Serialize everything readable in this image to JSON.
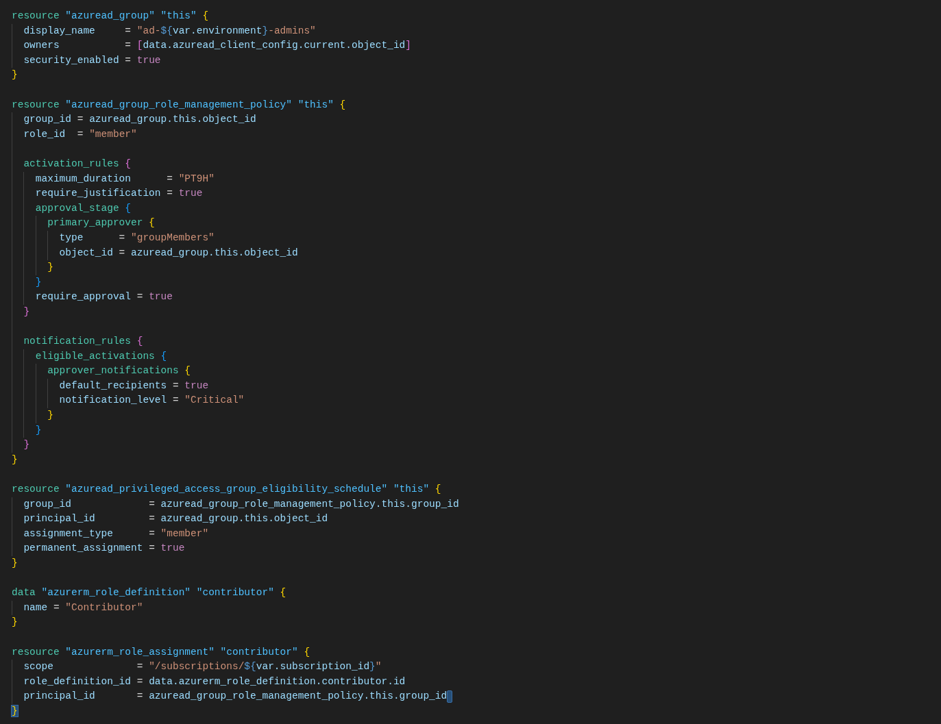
{
  "editor": {
    "lines": [
      {
        "kind": "block",
        "head": [
          {
            "text": "resource ",
            "kind": "kw"
          },
          {
            "text": "\"azuread_group\" \"this\" ",
            "kind": "rtype"
          },
          {
            "text": "{",
            "kind": "b1"
          }
        ],
        "children": [
          {
            "kind": "line",
            "cursor": false,
            "t": [
              {
                "text": "display_name     ",
                "kind": "attr"
              },
              {
                "text": "= ",
                "kind": "plain"
              },
              {
                "text": "\"ad-",
                "kind": "str"
              },
              {
                "text": "${",
                "kind": "interp"
              },
              {
                "text": "var.environment",
                "kind": "attr"
              },
              {
                "text": "}",
                "kind": "interp"
              },
              {
                "text": "-admins\"",
                "kind": "str"
              }
            ]
          },
          {
            "kind": "line",
            "cursor": false,
            "t": [
              {
                "text": "owners           ",
                "kind": "attr"
              },
              {
                "text": "= ",
                "kind": "plain"
              },
              {
                "text": "[",
                "kind": "b2"
              },
              {
                "text": "data.azuread_client_config.current.object_id",
                "kind": "attr"
              },
              {
                "text": "]",
                "kind": "b2"
              }
            ]
          },
          {
            "kind": "line",
            "cursor": false,
            "t": [
              {
                "text": "security_enabled ",
                "kind": "attr"
              },
              {
                "text": "= ",
                "kind": "plain"
              },
              {
                "text": "true",
                "kind": "bool"
              }
            ]
          }
        ],
        "close": {
          "t": [
            {
              "text": "}",
              "kind": "b1"
            }
          ],
          "matched": false
        }
      },
      {
        "kind": "blank"
      },
      {
        "kind": "block",
        "head": [
          {
            "text": "resource ",
            "kind": "kw"
          },
          {
            "text": "\"azuread_group_role_management_policy\" \"this\" ",
            "kind": "rtype"
          },
          {
            "text": "{",
            "kind": "b1"
          }
        ],
        "children": [
          {
            "kind": "line",
            "cursor": false,
            "t": [
              {
                "text": "group_id ",
                "kind": "attr"
              },
              {
                "text": "= ",
                "kind": "plain"
              },
              {
                "text": "azuread_group.this.object_id",
                "kind": "attr"
              }
            ]
          },
          {
            "kind": "line",
            "cursor": false,
            "t": [
              {
                "text": "role_id  ",
                "kind": "attr"
              },
              {
                "text": "= ",
                "kind": "plain"
              },
              {
                "text": "\"member\"",
                "kind": "str"
              }
            ]
          },
          {
            "kind": "blank"
          },
          {
            "kind": "block",
            "head": [
              {
                "text": "activation_rules ",
                "kind": "block"
              },
              {
                "text": "{",
                "kind": "b2"
              }
            ],
            "children": [
              {
                "kind": "line",
                "cursor": false,
                "t": [
                  {
                    "text": "maximum_duration      ",
                    "kind": "attr"
                  },
                  {
                    "text": "= ",
                    "kind": "plain"
                  },
                  {
                    "text": "\"PT9H\"",
                    "kind": "str"
                  }
                ]
              },
              {
                "kind": "line",
                "cursor": false,
                "t": [
                  {
                    "text": "require_justification ",
                    "kind": "attr"
                  },
                  {
                    "text": "= ",
                    "kind": "plain"
                  },
                  {
                    "text": "true",
                    "kind": "bool"
                  }
                ]
              },
              {
                "kind": "block",
                "head": [
                  {
                    "text": "approval_stage ",
                    "kind": "block"
                  },
                  {
                    "text": "{",
                    "kind": "b3"
                  }
                ],
                "children": [
                  {
                    "kind": "block",
                    "head": [
                      {
                        "text": "primary_approver ",
                        "kind": "block"
                      },
                      {
                        "text": "{",
                        "kind": "b1"
                      }
                    ],
                    "children": [
                      {
                        "kind": "line",
                        "cursor": false,
                        "t": [
                          {
                            "text": "type      ",
                            "kind": "attr"
                          },
                          {
                            "text": "= ",
                            "kind": "plain"
                          },
                          {
                            "text": "\"groupMembers\"",
                            "kind": "str"
                          }
                        ]
                      },
                      {
                        "kind": "line",
                        "cursor": false,
                        "t": [
                          {
                            "text": "object_id ",
                            "kind": "attr"
                          },
                          {
                            "text": "= ",
                            "kind": "plain"
                          },
                          {
                            "text": "azuread_group.this.object_id",
                            "kind": "attr"
                          }
                        ]
                      }
                    ],
                    "close": {
                      "t": [
                        {
                          "text": "}",
                          "kind": "b1"
                        }
                      ],
                      "matched": false
                    }
                  }
                ],
                "close": {
                  "t": [
                    {
                      "text": "}",
                      "kind": "b3"
                    }
                  ],
                  "matched": false
                }
              },
              {
                "kind": "line",
                "cursor": false,
                "t": [
                  {
                    "text": "require_approval ",
                    "kind": "attr"
                  },
                  {
                    "text": "= ",
                    "kind": "plain"
                  },
                  {
                    "text": "true",
                    "kind": "bool"
                  }
                ]
              }
            ],
            "close": {
              "t": [
                {
                  "text": "}",
                  "kind": "b2"
                }
              ],
              "matched": false
            }
          },
          {
            "kind": "blank"
          },
          {
            "kind": "block",
            "head": [
              {
                "text": "notification_rules ",
                "kind": "block"
              },
              {
                "text": "{",
                "kind": "b2"
              }
            ],
            "children": [
              {
                "kind": "block",
                "head": [
                  {
                    "text": "eligible_activations ",
                    "kind": "block"
                  },
                  {
                    "text": "{",
                    "kind": "b3"
                  }
                ],
                "children": [
                  {
                    "kind": "block",
                    "head": [
                      {
                        "text": "approver_notifications ",
                        "kind": "block"
                      },
                      {
                        "text": "{",
                        "kind": "b1"
                      }
                    ],
                    "children": [
                      {
                        "kind": "line",
                        "cursor": false,
                        "t": [
                          {
                            "text": "default_recipients ",
                            "kind": "attr"
                          },
                          {
                            "text": "= ",
                            "kind": "plain"
                          },
                          {
                            "text": "true",
                            "kind": "bool"
                          }
                        ]
                      },
                      {
                        "kind": "line",
                        "cursor": false,
                        "t": [
                          {
                            "text": "notification_level ",
                            "kind": "attr"
                          },
                          {
                            "text": "= ",
                            "kind": "plain"
                          },
                          {
                            "text": "\"Critical\"",
                            "kind": "str"
                          }
                        ]
                      }
                    ],
                    "close": {
                      "t": [
                        {
                          "text": "}",
                          "kind": "b1"
                        }
                      ],
                      "matched": false
                    }
                  }
                ],
                "close": {
                  "t": [
                    {
                      "text": "}",
                      "kind": "b3"
                    }
                  ],
                  "matched": false
                }
              }
            ],
            "close": {
              "t": [
                {
                  "text": "}",
                  "kind": "b2"
                }
              ],
              "matched": false
            }
          }
        ],
        "close": {
          "t": [
            {
              "text": "}",
              "kind": "b1"
            }
          ],
          "matched": false
        }
      },
      {
        "kind": "blank"
      },
      {
        "kind": "block",
        "head": [
          {
            "text": "resource ",
            "kind": "kw"
          },
          {
            "text": "\"azuread_privileged_access_group_eligibility_schedule\" \"this\" ",
            "kind": "rtype"
          },
          {
            "text": "{",
            "kind": "b1"
          }
        ],
        "children": [
          {
            "kind": "line",
            "cursor": false,
            "t": [
              {
                "text": "group_id             ",
                "kind": "attr"
              },
              {
                "text": "= ",
                "kind": "plain"
              },
              {
                "text": "azuread_group_role_management_policy.this.group_id",
                "kind": "attr"
              }
            ]
          },
          {
            "kind": "line",
            "cursor": false,
            "t": [
              {
                "text": "principal_id         ",
                "kind": "attr"
              },
              {
                "text": "= ",
                "kind": "plain"
              },
              {
                "text": "azuread_group.this.object_id",
                "kind": "attr"
              }
            ]
          },
          {
            "kind": "line",
            "cursor": false,
            "t": [
              {
                "text": "assignment_type      ",
                "kind": "attr"
              },
              {
                "text": "= ",
                "kind": "plain"
              },
              {
                "text": "\"member\"",
                "kind": "str"
              }
            ]
          },
          {
            "kind": "line",
            "cursor": false,
            "t": [
              {
                "text": "permanent_assignment ",
                "kind": "attr"
              },
              {
                "text": "= ",
                "kind": "plain"
              },
              {
                "text": "true",
                "kind": "bool"
              }
            ]
          }
        ],
        "close": {
          "t": [
            {
              "text": "}",
              "kind": "b1"
            }
          ],
          "matched": false
        }
      },
      {
        "kind": "blank"
      },
      {
        "kind": "block",
        "head": [
          {
            "text": "data ",
            "kind": "kw"
          },
          {
            "text": "\"azurerm_role_definition\" \"contributor\" ",
            "kind": "rtype"
          },
          {
            "text": "{",
            "kind": "b1"
          }
        ],
        "children": [
          {
            "kind": "line",
            "cursor": false,
            "t": [
              {
                "text": "name ",
                "kind": "attr"
              },
              {
                "text": "= ",
                "kind": "plain"
              },
              {
                "text": "\"Contributor\"",
                "kind": "str"
              }
            ]
          }
        ],
        "close": {
          "t": [
            {
              "text": "}",
              "kind": "b1"
            }
          ],
          "matched": false
        }
      },
      {
        "kind": "blank"
      },
      {
        "kind": "block",
        "head": [
          {
            "text": "resource ",
            "kind": "kw"
          },
          {
            "text": "\"azurerm_role_assignment\" \"contributor\" ",
            "kind": "rtype"
          },
          {
            "text": "{",
            "kind": "b1"
          }
        ],
        "children": [
          {
            "kind": "line",
            "cursor": false,
            "t": [
              {
                "text": "scope              ",
                "kind": "attr"
              },
              {
                "text": "= ",
                "kind": "plain"
              },
              {
                "text": "\"/subscriptions/",
                "kind": "str"
              },
              {
                "text": "${",
                "kind": "interp"
              },
              {
                "text": "var.subscription_id",
                "kind": "attr"
              },
              {
                "text": "}",
                "kind": "interp"
              },
              {
                "text": "\"",
                "kind": "str"
              }
            ]
          },
          {
            "kind": "line",
            "cursor": false,
            "t": [
              {
                "text": "role_definition_id ",
                "kind": "attr"
              },
              {
                "text": "= ",
                "kind": "plain"
              },
              {
                "text": "data.azurerm_role_definition.contributor.id",
                "kind": "attr"
              }
            ]
          },
          {
            "kind": "line",
            "cursor": true,
            "t": [
              {
                "text": "principal_id       ",
                "kind": "attr"
              },
              {
                "text": "= ",
                "kind": "plain"
              },
              {
                "text": "azuread_group_role_management_policy.this.group_id",
                "kind": "attr"
              }
            ]
          }
        ],
        "close": {
          "t": [
            {
              "text": "}",
              "kind": "b1"
            }
          ],
          "matched": true
        }
      }
    ]
  }
}
